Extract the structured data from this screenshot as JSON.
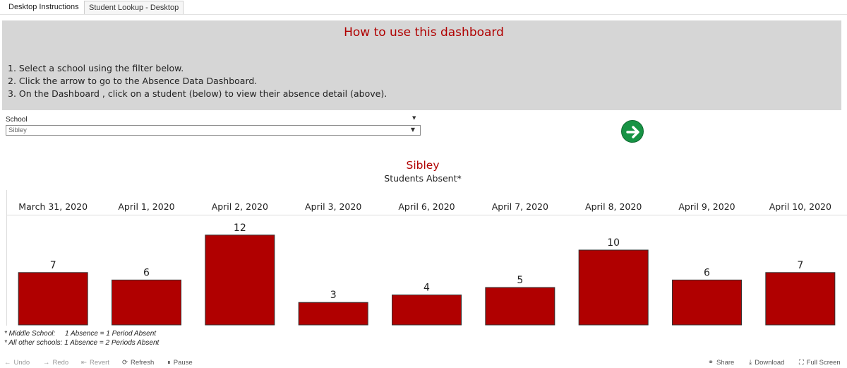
{
  "tabs": [
    {
      "label": "Desktop Instructions",
      "active": true
    },
    {
      "label": "Student Lookup - Desktop",
      "active": false
    }
  ],
  "instructions": {
    "title": "How to use this dashboard",
    "steps": [
      "1. Select a school using the filter below.",
      "2. Click the arrow to go to the Absence Data Dashboard.",
      "3. On the Dashboard , click on a student (below) to view their absence detail (above)."
    ]
  },
  "filter": {
    "label": "School",
    "value": "Sibley"
  },
  "chart_data": {
    "type": "bar",
    "title": "Sibley",
    "subtitle": "Students Absent*",
    "categories": [
      "March 31, 2020",
      "April 1, 2020",
      "April 2, 2020",
      "April 3, 2020",
      "April 6, 2020",
      "April 7, 2020",
      "April 8, 2020",
      "April 9, 2020",
      "April 10, 2020"
    ],
    "values": [
      7,
      6,
      12,
      3,
      4,
      5,
      10,
      6,
      7
    ],
    "ylim": [
      0,
      12
    ],
    "bar_color": "#b00000",
    "grid": false,
    "data_labels": true
  },
  "footnotes": [
    {
      "label": "* Middle School:",
      "text": "1 Absence = 1 Period Absent"
    },
    {
      "label": "* All other schools:",
      "text": "1 Absence = 2 Periods Absent"
    }
  ],
  "toolbar": {
    "undo": "Undo",
    "redo": "Redo",
    "revert": "Revert",
    "refresh": "Refresh",
    "pause": "Pause",
    "share": "Share",
    "download": "Download",
    "fullscreen": "Full Screen"
  },
  "colors": {
    "accent_red": "#b00000",
    "go_green": "#179344",
    "panel_gray": "#d6d6d6"
  },
  "icons": {
    "go": "arrow-right-circle-icon",
    "undo": "arrow-left-icon",
    "redo": "arrow-right-icon",
    "revert": "revert-icon",
    "refresh": "refresh-icon",
    "pause": "pause-icon",
    "share": "share-icon",
    "download": "download-icon",
    "fullscreen": "fullscreen-icon"
  }
}
